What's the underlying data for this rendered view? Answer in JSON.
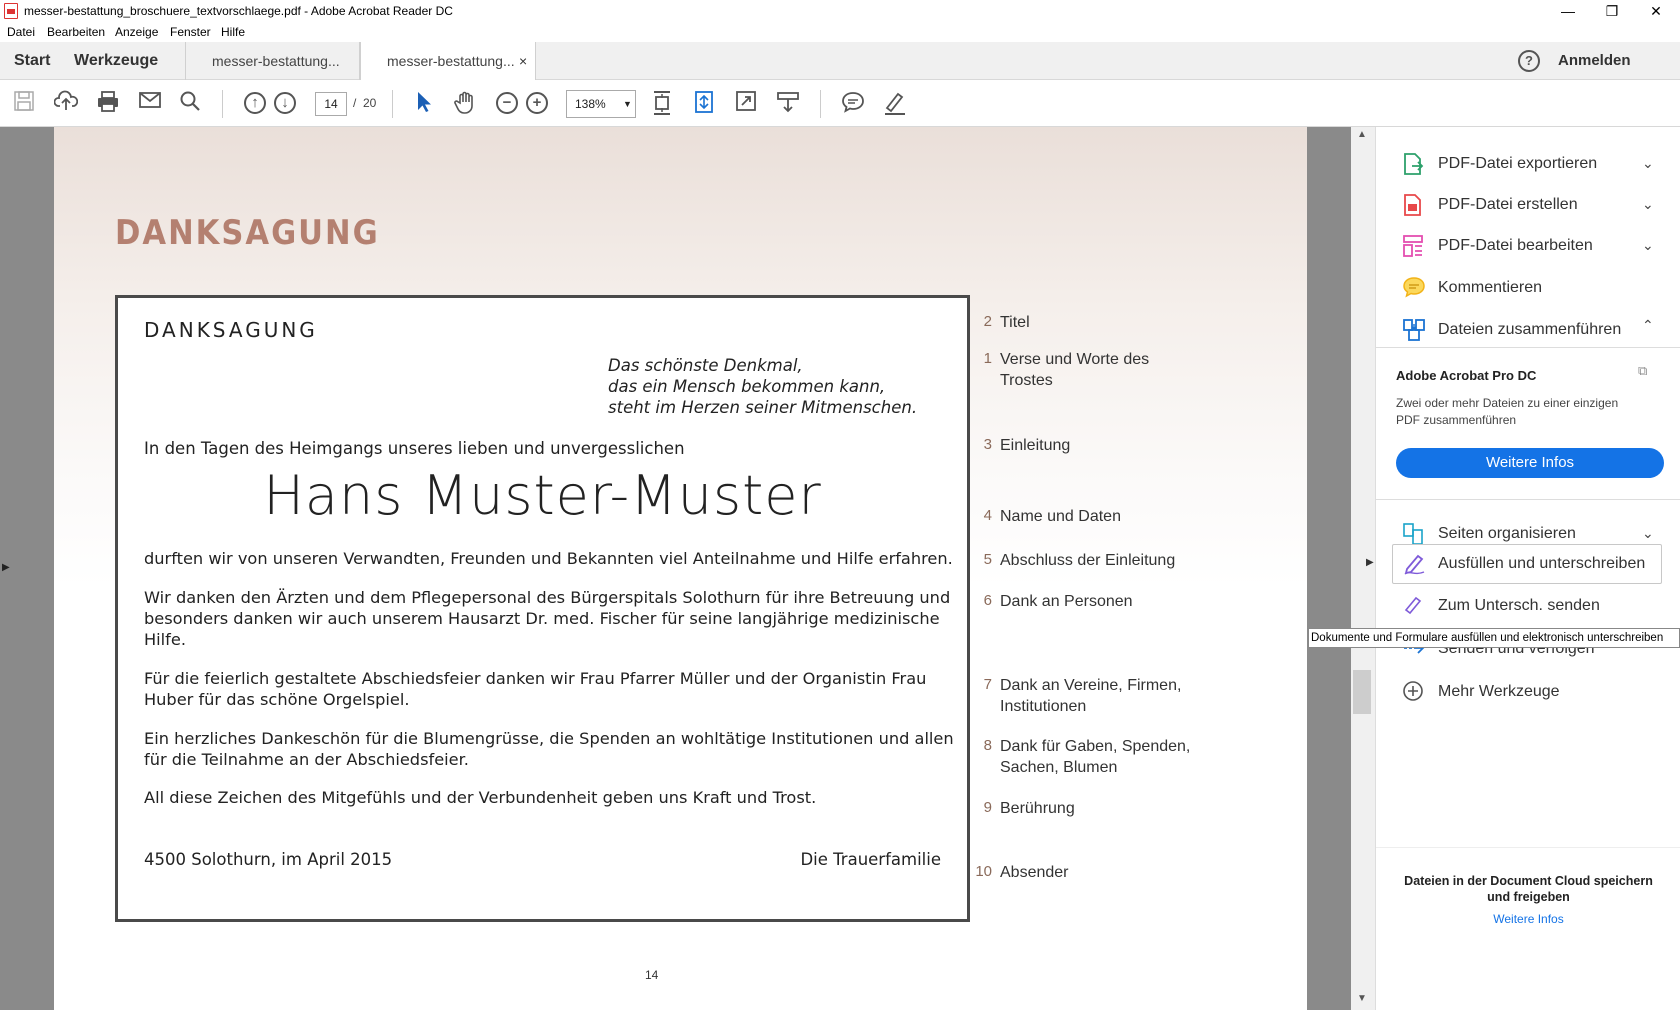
{
  "window": {
    "title": "messer-bestattung_broschuere_textvorschlaege.pdf - Adobe Acrobat Reader DC",
    "minimize": "—",
    "restore": "❐",
    "close": "✕"
  },
  "menu": [
    "Datei",
    "Bearbeiten",
    "Anzeige",
    "Fenster",
    "Hilfe"
  ],
  "tabs": {
    "start": "Start",
    "werkzeuge": "Werkzeuge",
    "doc1": "messer-bestattung...",
    "doc2": "messer-bestattung...",
    "close": "×",
    "help": "?",
    "signin": "Anmelden"
  },
  "toolbar": {
    "current_page": "14",
    "page_sep": "/",
    "total_pages": "20",
    "zoom": "138%"
  },
  "page": {
    "heading": "DANKSAGUNG",
    "page_number": "14",
    "card": {
      "title": "DANKSAGUNG",
      "verse": [
        "Das schönste Denkmal,",
        "das ein Mensch bekommen kann,",
        "steht im Herzen seiner Mitmenschen."
      ],
      "intro": "In den Tagen des Heimgangs unseres lieben und unvergesslichen",
      "name": "Hans Muster-Muster",
      "intro_end": "durften wir von unseren Verwandten, Freunden und Bekannten viel Anteilnahme und Hilfe erfahren.",
      "p1": [
        "Wir danken den Ärzten und dem Pflegepersonal des Bürgerspitals Solothurn für ihre Betreuung und",
        "besonders danken wir auch unserem Hausarzt Dr. med. Fischer für seine langjährige medizinische",
        "Hilfe."
      ],
      "p2": [
        "Für die feierlich gestaltete Abschiedsfeier danken wir Frau Pfarrer Müller und der Organistin Frau",
        "Huber für das schöne Orgelspiel."
      ],
      "p3": [
        "Ein herzliches Dankeschön für die Blumengrüsse, die Spenden an wohltätige Institutionen und allen",
        "für die Teilnahme an der Abschiedsfeier."
      ],
      "p4": "All diese Zeichen des Mitgefühls und der Verbundenheit geben uns Kraft und Trost.",
      "place_date": "4500 Solothurn, im April 2015",
      "sender": "Die Trauerfamilie"
    },
    "labels": [
      {
        "num": "2",
        "lines": [
          "Titel"
        ]
      },
      {
        "num": "1",
        "lines": [
          "Verse und Worte des",
          "Trostes"
        ]
      },
      {
        "num": "3",
        "lines": [
          "Einleitung"
        ]
      },
      {
        "num": "4",
        "lines": [
          "Name und Daten"
        ]
      },
      {
        "num": "5",
        "lines": [
          "Abschluss der Einleitung"
        ]
      },
      {
        "num": "6",
        "lines": [
          "Dank an Personen"
        ]
      },
      {
        "num": "7",
        "lines": [
          "Dank an Vereine, Firmen,",
          "Institutionen"
        ]
      },
      {
        "num": "8",
        "lines": [
          "Dank für Gaben, Spenden,",
          "Sachen, Blumen"
        ]
      },
      {
        "num": "9",
        "lines": [
          "Berührung"
        ]
      },
      {
        "num": "10",
        "lines": [
          "Absender"
        ]
      }
    ]
  },
  "panel": {
    "tools": [
      {
        "label": "PDF-Datei exportieren",
        "icon": "export-pdf-icon",
        "color": "#2da06b"
      },
      {
        "label": "PDF-Datei erstellen",
        "icon": "create-pdf-icon",
        "color": "#e8484a"
      },
      {
        "label": "PDF-Datei bearbeiten",
        "icon": "edit-pdf-icon",
        "color": "#e44fb1"
      },
      {
        "label": "Kommentieren",
        "icon": "comment-icon",
        "color": "#f2b318"
      },
      {
        "label": "Dateien zusammenführen",
        "icon": "combine-icon",
        "color": "#1b73d3"
      }
    ],
    "promo_title": "Adobe Acrobat Pro DC",
    "promo_text": [
      "Zwei oder mehr Dateien zu einer einzigen",
      "PDF zusammenführen"
    ],
    "promo_button": "Weitere Infos",
    "tools2": [
      {
        "label": "Seiten organisieren",
        "icon": "organize-pages-icon",
        "color": "#1aa3c9"
      },
      {
        "label": "Ausfüllen und unterschreiben",
        "icon": "fill-sign-icon",
        "color": "#7f5bd9"
      },
      {
        "label": "Zum Untersch. senden",
        "icon": "send-sign-icon",
        "color": "#7f5bd9"
      },
      {
        "label": "Senden und verfolgen",
        "icon": "send-track-icon",
        "color": "#1b73d3"
      },
      {
        "label": "Mehr Werkzeuge",
        "icon": "more-tools-icon",
        "color": "#555555"
      }
    ],
    "tooltip": "Dokumente und Formulare ausfüllen und elektronisch unterschreiben",
    "cloud_text": [
      "Dateien in der Document Cloud speichern",
      "und freigeben"
    ],
    "cloud_link": "Weitere Infos"
  }
}
